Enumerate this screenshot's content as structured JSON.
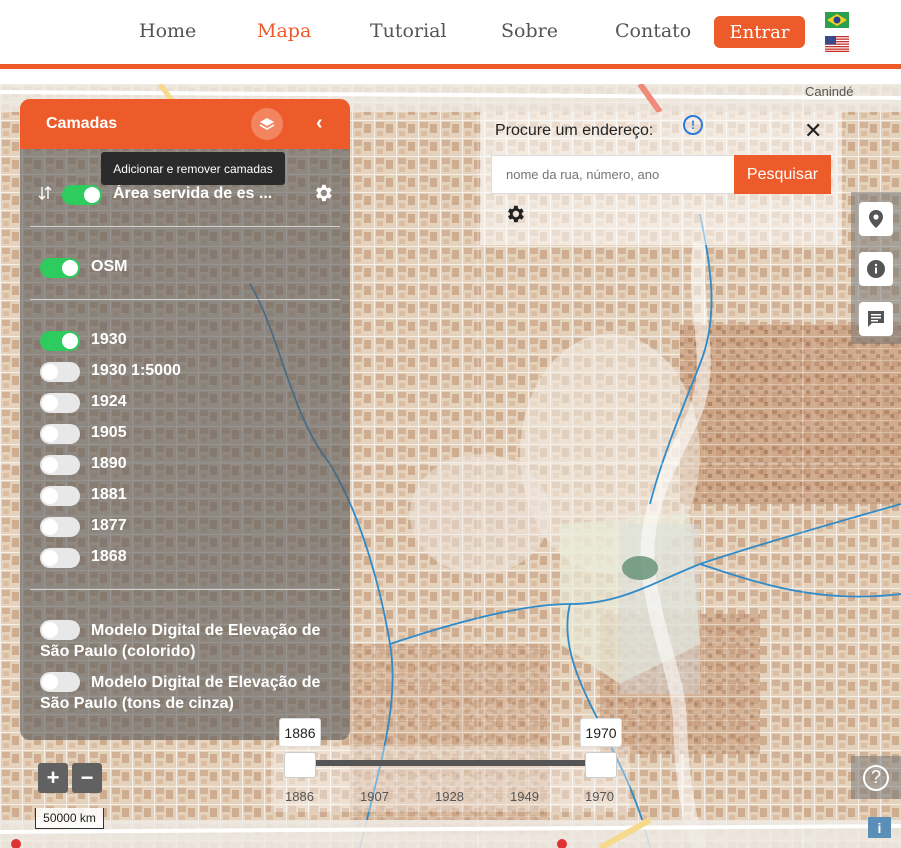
{
  "nav": {
    "items": [
      {
        "label": "Home",
        "active": false
      },
      {
        "label": "Mapa",
        "active": true
      },
      {
        "label": "Tutorial",
        "active": false
      },
      {
        "label": "Sobre",
        "active": false
      },
      {
        "label": "Contato",
        "active": false
      }
    ],
    "login_label": "Entrar",
    "accent": "#ee5b2b"
  },
  "map_labels": {
    "caninde": "Canindé"
  },
  "layers_panel": {
    "title": "Camadas",
    "tooltip": "Adicionar e remover camadas",
    "top_layer": {
      "label": "Área servida de es ...",
      "on": true
    },
    "osm": {
      "label": "OSM",
      "on": true
    },
    "years": [
      {
        "label": "1930",
        "on": true
      },
      {
        "label": "1930 1:5000",
        "on": false
      },
      {
        "label": "1924",
        "on": false
      },
      {
        "label": "1905",
        "on": false
      },
      {
        "label": "1890",
        "on": false
      },
      {
        "label": "1881",
        "on": false
      },
      {
        "label": "1877",
        "on": false
      },
      {
        "label": "1868",
        "on": false
      }
    ],
    "elevation": [
      {
        "label": "Modelo Digital de Elevação de São Paulo (colorido)",
        "on": false
      },
      {
        "label": "Modelo Digital de Elevação de São Paulo (tons de cinza)",
        "on": false
      }
    ]
  },
  "search": {
    "label": "Procure um endereço:",
    "placeholder": "nome da rua, número, ano",
    "button": "Pesquisar"
  },
  "zoom": {
    "in": "+",
    "out": "−"
  },
  "scale_label": "50000 km",
  "timeline": {
    "start": "1886",
    "end": "1970",
    "ticks": [
      "1886",
      "1907",
      "1928",
      "1949",
      "1970"
    ]
  },
  "help": "?",
  "corner_info": "i"
}
